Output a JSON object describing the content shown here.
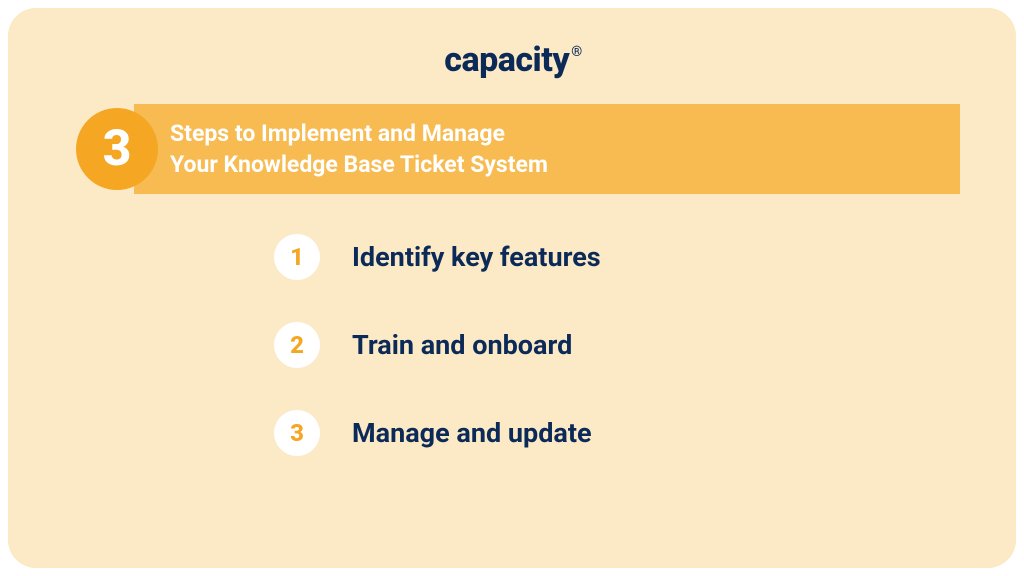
{
  "logo": {
    "text": "capacity",
    "registered": "®"
  },
  "header": {
    "badge_number": "3",
    "title_line1": "Steps to Implement and Manage",
    "title_line2": "Your Knowledge Base Ticket System"
  },
  "steps": [
    {
      "number": "1",
      "label": "Identify key features"
    },
    {
      "number": "2",
      "label": "Train and onboard"
    },
    {
      "number": "3",
      "label": "Manage and update"
    }
  ],
  "colors": {
    "card_bg": "#fce9c6",
    "accent_orange": "#f5a623",
    "title_bar": "#f7bb52",
    "navy": "#0c2a58",
    "white": "#ffffff"
  }
}
